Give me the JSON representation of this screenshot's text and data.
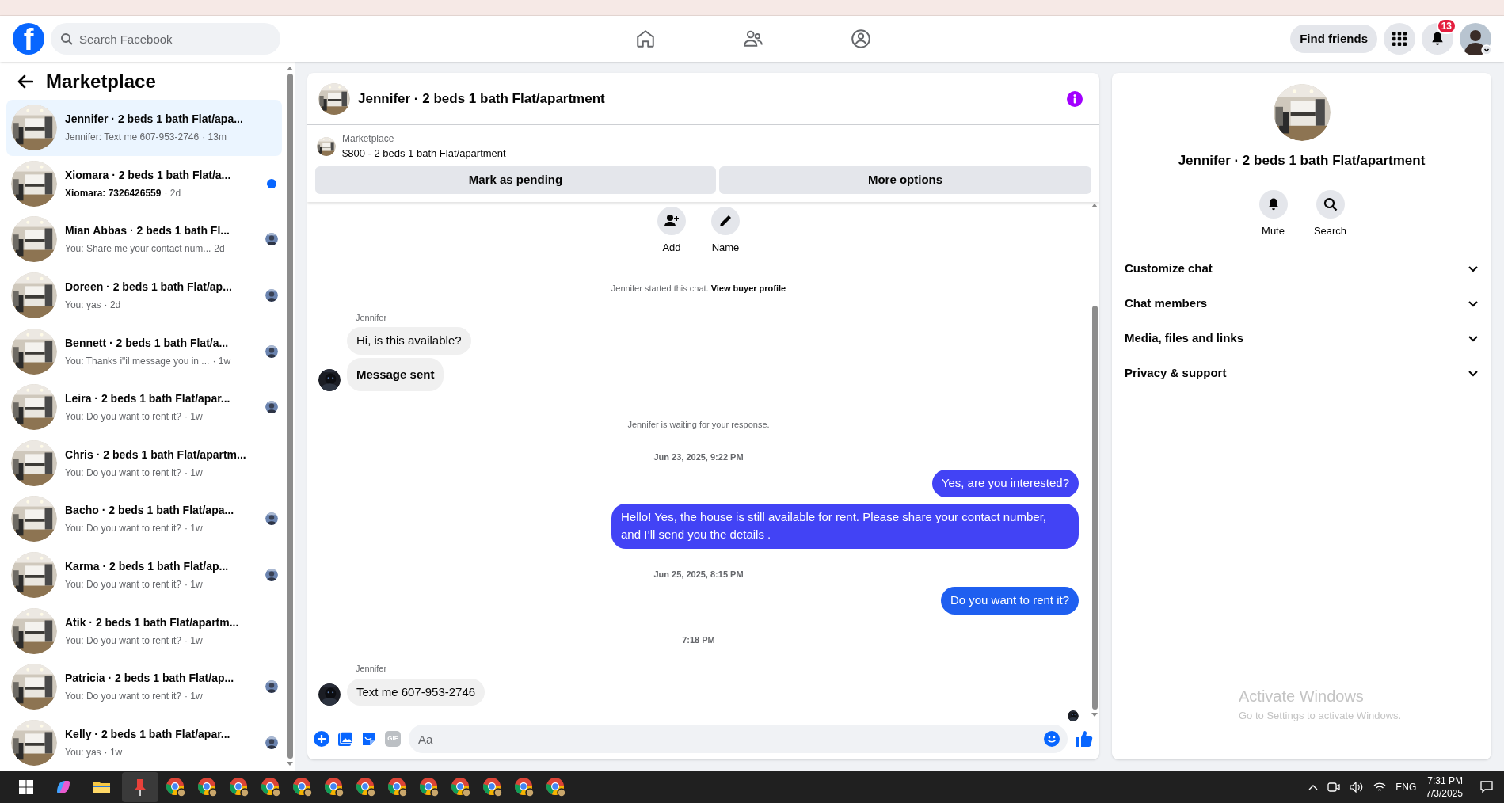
{
  "topbar": {
    "logo_letter": "f",
    "search": {
      "placeholder": "Search Facebook"
    },
    "find_friends": "Find friends",
    "notification_count": "13"
  },
  "sidebar": {
    "title": "Marketplace",
    "conversations": [
      {
        "title": "Jennifer · 2 beds 1 bath Flat/apa...",
        "preview": "Jennifer: Text me 607-953-2746",
        "time": "· 13m",
        "selected": true,
        "unread": false,
        "seen": false
      },
      {
        "title": "Xiomara · 2 beds 1 bath Flat/a...",
        "preview": "Xiomara: 7326426559",
        "time": "· 2d",
        "selected": false,
        "unread": true,
        "seen": false
      },
      {
        "title": "Mian Abbas · 2 beds 1 bath Fl...",
        "preview": "You: Share me your contact num...",
        "time": "2d",
        "selected": false,
        "unread": false,
        "seen": true
      },
      {
        "title": "Doreen · 2 beds 1 bath Flat/ap...",
        "preview": "You: yas",
        "time": "· 2d",
        "selected": false,
        "unread": false,
        "seen": true
      },
      {
        "title": "Bennett · 2 beds 1 bath Flat/a...",
        "preview": "You: Thanks i\"il message you in ...",
        "time": "· 1w",
        "selected": false,
        "unread": false,
        "seen": true
      },
      {
        "title": "Leira · 2 beds 1 bath Flat/apar...",
        "preview": "You: Do you want to rent it?",
        "time": "· 1w",
        "selected": false,
        "unread": false,
        "seen": true
      },
      {
        "title": "Chris · 2 beds 1 bath Flat/apartm...",
        "preview": "You: Do you want to rent it?",
        "time": "· 1w",
        "selected": false,
        "unread": false,
        "seen": false
      },
      {
        "title": "Bacho · 2 beds 1 bath Flat/apa...",
        "preview": "You: Do you want to rent it?",
        "time": "· 1w",
        "selected": false,
        "unread": false,
        "seen": true
      },
      {
        "title": "Karma · 2 beds 1 bath Flat/ap...",
        "preview": "You: Do you want to rent it?",
        "time": "· 1w",
        "selected": false,
        "unread": false,
        "seen": true
      },
      {
        "title": "Atik · 2 beds 1 bath Flat/apartm...",
        "preview": "You: Do you want to rent it?",
        "time": "· 1w",
        "selected": false,
        "unread": false,
        "seen": false
      },
      {
        "title": "Patricia · 2 beds 1 bath Flat/ap...",
        "preview": "You: Do you want to rent it?",
        "time": "· 1w",
        "selected": false,
        "unread": false,
        "seen": true
      },
      {
        "title": "Kelly · 2 beds 1 bath Flat/apar...",
        "preview": "You: yas",
        "time": "· 1w",
        "selected": false,
        "unread": false,
        "seen": true
      }
    ]
  },
  "chat": {
    "title": "Jennifer · 2 beds 1 bath Flat/apartment",
    "listing": {
      "source": "Marketplace",
      "description": "$800 - 2 beds 1 bath Flat/apartment"
    },
    "buttons": [
      "Mark as pending",
      "More options"
    ],
    "quick_actions": [
      {
        "kind": "add",
        "label": "Add"
      },
      {
        "kind": "name",
        "label": "Name"
      }
    ],
    "messages": [
      {
        "kind": "notice",
        "text": "Jennifer started this chat.",
        "link": "View buyer profile"
      },
      {
        "kind": "sender",
        "text": "Jennifer"
      },
      {
        "kind": "incoming",
        "text": "Hi, is this available?",
        "avatar": false,
        "emphasis": false
      },
      {
        "kind": "incoming",
        "text": "Message sent",
        "avatar": true,
        "emphasis": true
      },
      {
        "kind": "notice",
        "text": "Jennifer is waiting for your response."
      },
      {
        "kind": "timestamp",
        "text": "Jun 23, 2025, 9:22 PM"
      },
      {
        "kind": "outgoing",
        "text": "Yes, are you interested?",
        "color": "#4243f5"
      },
      {
        "kind": "outgoing",
        "text": "Hello! Yes, the house is still available for rent. Please share your contact number, and I’ll send you the details .",
        "color": "#4243f5"
      },
      {
        "kind": "timestamp",
        "text": "Jun 25, 2025, 8:15 PM"
      },
      {
        "kind": "outgoing",
        "text": "Do you want to rent it?",
        "color": "#1f5ff0"
      },
      {
        "kind": "timestamp",
        "text": "7:18 PM"
      },
      {
        "kind": "sender",
        "text": "Jennifer"
      },
      {
        "kind": "incoming",
        "text": "Text me 607-953-2746",
        "avatar": true,
        "emphasis": false
      }
    ],
    "composer": {
      "gif_label": "GIF",
      "placeholder": "Aa"
    }
  },
  "details": {
    "title": "Jennifer · 2 beds 1 bath Flat/apartment",
    "actions": [
      {
        "kind": "mute",
        "label": "Mute"
      },
      {
        "kind": "search",
        "label": "Search"
      }
    ],
    "sections": [
      {
        "label": "Customize chat",
        "expanded": false
      },
      {
        "label": "Chat members",
        "expanded": false
      },
      {
        "label": "Media, files and links",
        "expanded": false
      },
      {
        "label": "Privacy & support",
        "expanded": false
      }
    ]
  },
  "os_notice": {
    "title": "Activate Windows",
    "subtitle": "Go to Settings to activate Windows."
  },
  "taskbar": {
    "language": "ENG",
    "time": "7:31 PM",
    "date": "7/3/2025"
  }
}
